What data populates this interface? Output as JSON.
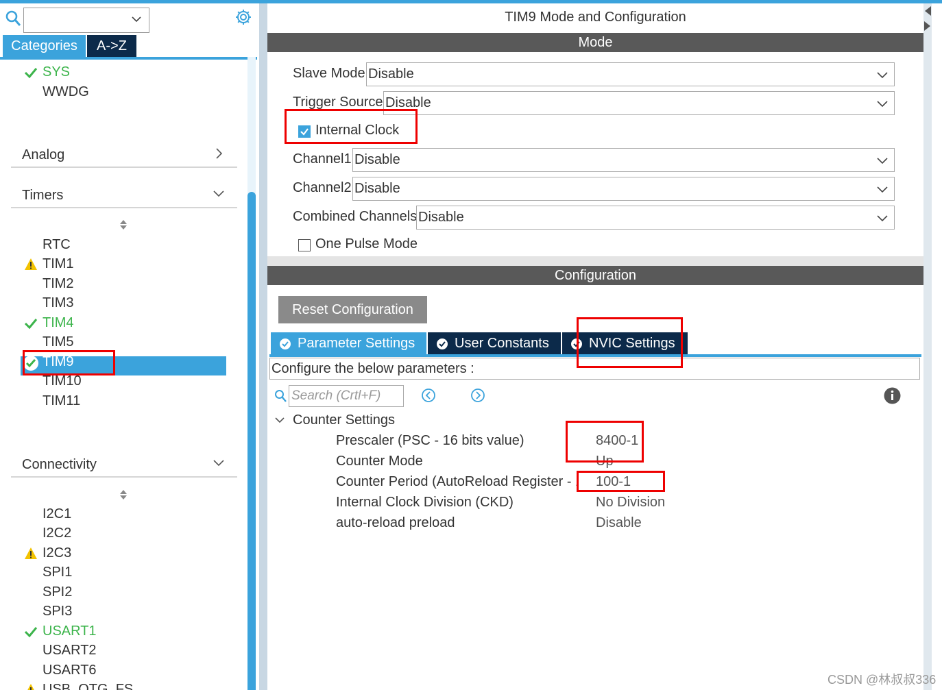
{
  "left_panel": {
    "search_value": "",
    "tabs": {
      "categories": "Categories",
      "az": "A->Z"
    },
    "system_items": [
      {
        "label": "SYS",
        "status": "ok"
      },
      {
        "label": "WWDG",
        "status": ""
      }
    ],
    "sections": {
      "analog": "Analog",
      "timers": "Timers",
      "connectivity": "Connectivity"
    },
    "timers": [
      {
        "label": "RTC",
        "status": ""
      },
      {
        "label": "TIM1",
        "status": "warning"
      },
      {
        "label": "TIM2",
        "status": ""
      },
      {
        "label": "TIM3",
        "status": ""
      },
      {
        "label": "TIM4",
        "status": "ok"
      },
      {
        "label": "TIM5",
        "status": ""
      },
      {
        "label": "TIM9",
        "status": "ok",
        "selected": true
      },
      {
        "label": "TIM10",
        "status": ""
      },
      {
        "label": "TIM11",
        "status": ""
      }
    ],
    "connectivity": [
      {
        "label": "I2C1",
        "status": ""
      },
      {
        "label": "I2C2",
        "status": ""
      },
      {
        "label": "I2C3",
        "status": "warning"
      },
      {
        "label": "SPI1",
        "status": ""
      },
      {
        "label": "SPI2",
        "status": ""
      },
      {
        "label": "SPI3",
        "status": ""
      },
      {
        "label": "USART1",
        "status": "ok"
      },
      {
        "label": "USART2",
        "status": ""
      },
      {
        "label": "USART6",
        "status": ""
      },
      {
        "label": "USB_OTG_FS",
        "status": "warning"
      }
    ]
  },
  "main": {
    "title": "TIM9 Mode and Configuration",
    "mode_header": "Mode",
    "mode": {
      "slave_mode": {
        "label": "Slave Mode",
        "value": "Disable"
      },
      "trigger_source": {
        "label": "Trigger Source",
        "value": "Disable"
      },
      "internal_clock": {
        "label": "Internal Clock",
        "checked": true
      },
      "channel1": {
        "label": "Channel1",
        "value": "Disable"
      },
      "channel2": {
        "label": "Channel2",
        "value": "Disable"
      },
      "combined_channels": {
        "label": "Combined Channels",
        "value": "Disable"
      },
      "one_pulse_mode": {
        "label": "One Pulse Mode",
        "checked": false
      }
    },
    "config_header": "Configuration",
    "reset_button": "Reset Configuration",
    "tabs": [
      "Parameter Settings",
      "User Constants",
      "NVIC Settings"
    ],
    "configure_text": "Configure the below parameters :",
    "search_placeholder": "Search (Crtl+F)",
    "group": "Counter Settings",
    "params": [
      {
        "label": "Prescaler (PSC - 16 bits value)",
        "value": "8400-1"
      },
      {
        "label": "Counter Mode",
        "value": "Up"
      },
      {
        "label": "Counter Period (AutoReload Register - 1...",
        "value": "100-1"
      },
      {
        "label": "Internal Clock Division (CKD)",
        "value": "No Division"
      },
      {
        "label": "auto-reload preload",
        "value": "Disable"
      }
    ]
  },
  "watermark": "CSDN @林叔叔336",
  "colors": {
    "accent": "#3ba3dc",
    "dark_tab": "#0c2a4a",
    "header_bar": "#595959",
    "ok": "#3cb44b",
    "warning": "#f2c200",
    "highlight": "#e00000"
  }
}
